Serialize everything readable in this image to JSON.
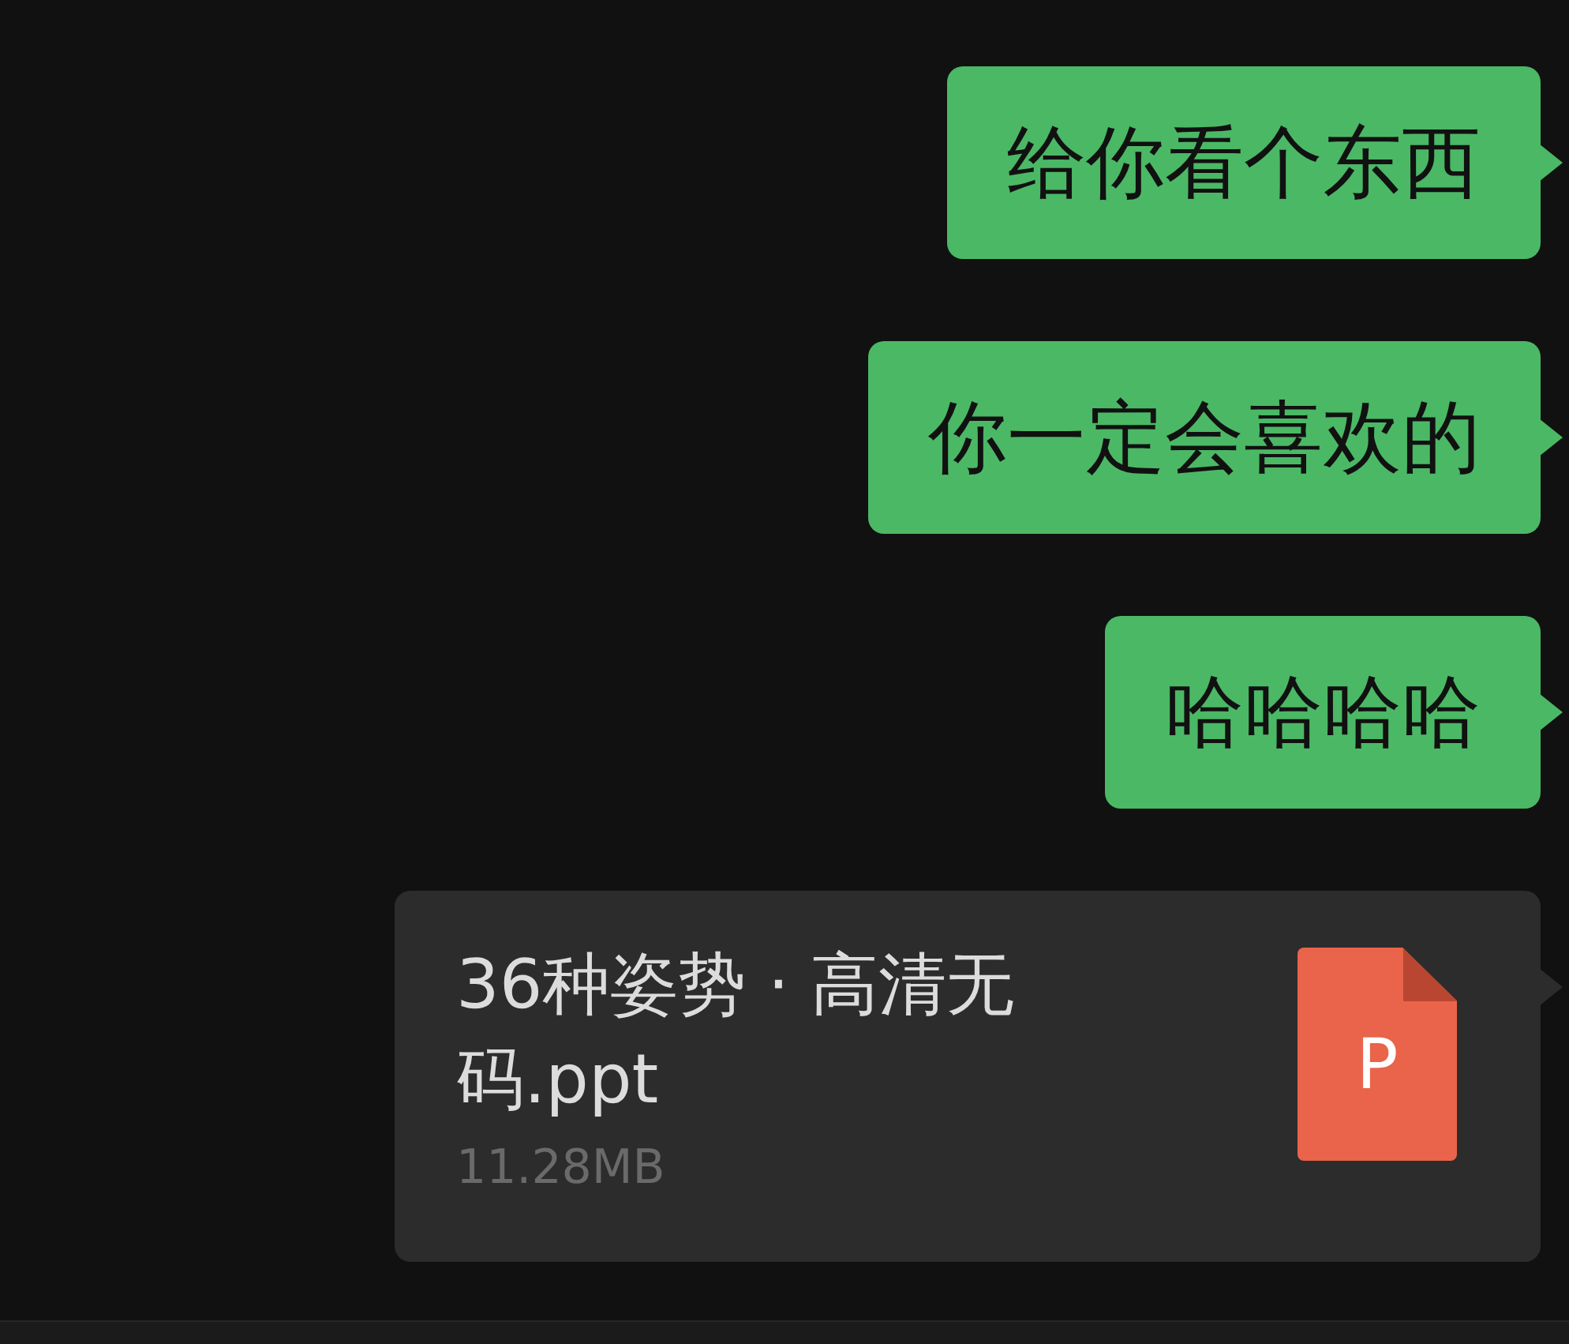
{
  "messages": [
    {
      "kind": "text",
      "text": "给你看个东西"
    },
    {
      "kind": "text",
      "text": "你一定会喜欢的"
    },
    {
      "kind": "text",
      "text": "哈哈哈哈"
    },
    {
      "kind": "file",
      "name": "36种姿势 · 高清无码.ppt",
      "size": "11.28MB",
      "icon_letter": "P"
    }
  ]
}
